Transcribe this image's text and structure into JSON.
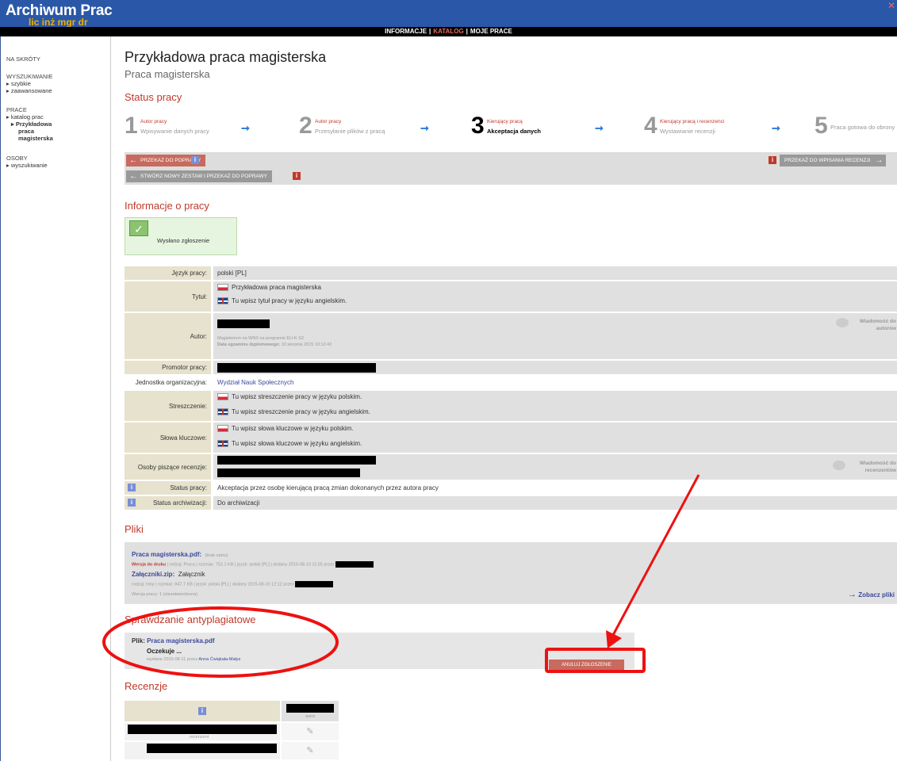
{
  "header": {
    "logo": "Archiwum Prac",
    "logo_sub": "lic inż mgr dr",
    "close_glyph": "✕"
  },
  "topnav": {
    "items": [
      "INFORMACJE",
      "KATALOG",
      "MOJE PRACE"
    ],
    "active": "KATALOG"
  },
  "sidebar": {
    "shortcuts_head": "NA SKRÓTY",
    "search_head": "WYSZUKIWANIE",
    "search_items": [
      "szybkie",
      "zaawansowane"
    ],
    "works_head": "PRACE",
    "works_items": [
      "katalog prac",
      "Przykładowa",
      "praca",
      "magisterska"
    ],
    "people_head": "OSOBY",
    "people_items": [
      "wyszukiwanie"
    ]
  },
  "page": {
    "title": "Przykładowa praca magisterska",
    "subtitle": "Praca magisterska"
  },
  "status": {
    "title": "Status pracy",
    "steps": [
      {
        "num": "1",
        "top": "Autor pracy",
        "bottom": "Wpisywanie danych pracy"
      },
      {
        "num": "2",
        "top": "Autor pracy",
        "bottom": "Przesyłanie plików z pracą"
      },
      {
        "num": "3",
        "top": "Kierujący pracą",
        "bottom": "Akceptacja danych"
      },
      {
        "num": "4",
        "top": "Kierujący pracą i recenzenci",
        "bottom": "Wystawianie recenzji"
      },
      {
        "num": "5",
        "top": "",
        "bottom": "Praca gotowa do obrony"
      }
    ],
    "current_step": 3
  },
  "actions": {
    "return_label": "PRZEKAŻ DO POPRAWY",
    "new_set_label": "STWÓRZ NOWY ZESTAW I PRZEKAŻ DO POPRAWY",
    "review_label": "PRZEKAŻ DO WPISANIA RECENZJI",
    "info_glyph": "i"
  },
  "info": {
    "title": "Informacje o pracy",
    "sent_label": "Wysłano zgłoszenie",
    "language_label": "Język pracy:",
    "language_value": "polski [PL]",
    "title_label": "Tytuł:",
    "title_pl": "Przykładowa praca magisterska",
    "title_en": "Tu wpisz tytuł pracy w języku angielskim.",
    "author_label": "Autor:",
    "author_program": "Magisterium na WNS na programie EU-K-S2",
    "author_exam_label": "Data egzaminu dyplomowego:",
    "author_exam_date": "10 sierpnia 2015 10:12:42",
    "msg_authors": "Wiadomość do autorów",
    "supervisor_label": "Promotor pracy:",
    "unit_label": "Jednostka organizacyjna:",
    "unit_value": "Wydział Nauk Społecznych",
    "abstract_label": "Streszczenie:",
    "abstract_pl": "Tu wpisz streszczenie pracy w języku polskim.",
    "abstract_en": "Tu wpisz streszczenie pracy w języku angielskim.",
    "keywords_label": "Słowa kluczowe:",
    "keywords_pl": "Tu wpisz słowa kluczowe w języku polskim.",
    "keywords_en": "Tu wpisz słowa kluczowe w języku angielskim.",
    "reviewers_label": "Osoby piszące recenzje:",
    "msg_reviewers": "Wiadomość do recenzentów",
    "status_label": "Status pracy:",
    "status_value": "Akceptacja przez osobę kierującą pracą zmian dokonanych przez autora pracy",
    "archive_label": "Status archiwizacji:",
    "archive_value": "Do archiwizacji"
  },
  "files": {
    "title": "Pliki",
    "file1_name": "Praca magisterska.pdf:",
    "file1_desc": "(brak opisu)",
    "file1_version": "Wersja do druku",
    "file1_meta": "| rodzaj: Praca | rozmiar: 752.1 KB | język: polski [PL] | dodany 2015-08-10 11:55 przez",
    "file2_name": "Załączniki.zip:",
    "file2_type": "Załącznik",
    "file2_meta": "rodzaj: Inny | rozmiar: 847.7 KB | język: polski [PL] | dodany 2015-08-10 12:12 przez",
    "version_note": "Wersja pracy: 1 (niezatwierdzona)",
    "see_files": "Zobacz pliki"
  },
  "plagiarism": {
    "title": "Sprawdzanie antyplagiatowe",
    "file_label": "Plik:",
    "file_name": "Praca magisterska.pdf",
    "state": "Oczekuje ...",
    "sent_info": "wysłane 2015-08-11 przez",
    "sent_by": "Anna Ćwiąkała-Małys",
    "cancel_label": "ANULUJ ZGŁOSZENIE"
  },
  "reviews": {
    "title": "Recenzje",
    "author_col": "autor",
    "reviewer_label": "recenzent"
  },
  "colors": {
    "header_blue": "#2a57a8",
    "accent_red": "#c0392b",
    "annotation_red": "#ee1111"
  }
}
